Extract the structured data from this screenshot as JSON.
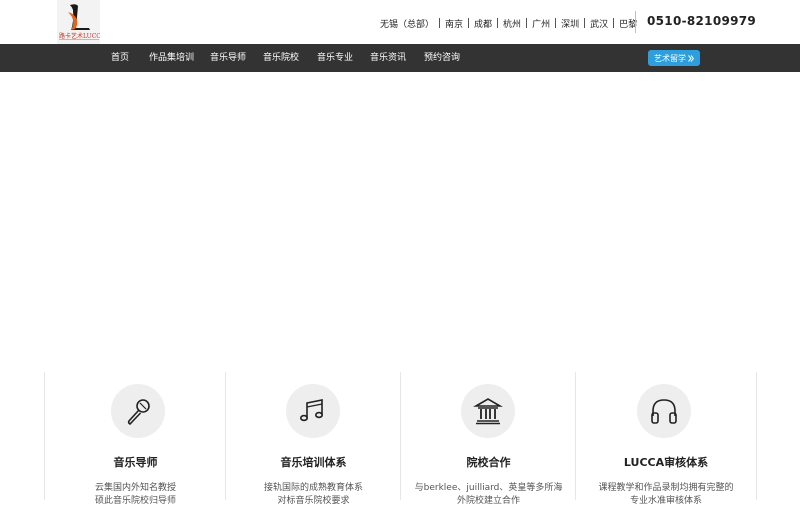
{
  "header": {
    "logo": {
      "brand_text": "路卡艺术LUCCA"
    },
    "cities": [
      "无锡（总部）",
      "南京",
      "成都",
      "杭州",
      "广州",
      "深圳",
      "武汉",
      "巴黎"
    ],
    "phone": "0510-82109979"
  },
  "nav": {
    "items": [
      "首页",
      "作品集培训",
      "音乐导师",
      "音乐院校",
      "音乐专业",
      "音乐资讯",
      "预约咨询"
    ],
    "cta_label": "艺术留学"
  },
  "features": [
    {
      "icon": "microphone-icon",
      "title": "音乐导师",
      "lines": [
        "云集国内外知名教授",
        "硕此音乐院校归导师"
      ]
    },
    {
      "icon": "music-notes-icon",
      "title": "音乐培训体系",
      "lines": [
        "接轨国际的成熟教育体系",
        "对标音乐院校要求"
      ]
    },
    {
      "icon": "university-icon",
      "title": "院校合作",
      "lines": [
        "与berklee、juilliard、英皇等多所海",
        "外院校建立合作"
      ]
    },
    {
      "icon": "headphones-icon",
      "title": "LUCCA审核体系",
      "lines": [
        "课程教学和作品录制均拥有完整的",
        "专业水准审核体系"
      ]
    }
  ],
  "colors": {
    "navbar_bg": "#333333",
    "cta_bg": "#2e9fdc",
    "logo_accent": "#c0392b",
    "icon_circle": "#eeeeee"
  }
}
